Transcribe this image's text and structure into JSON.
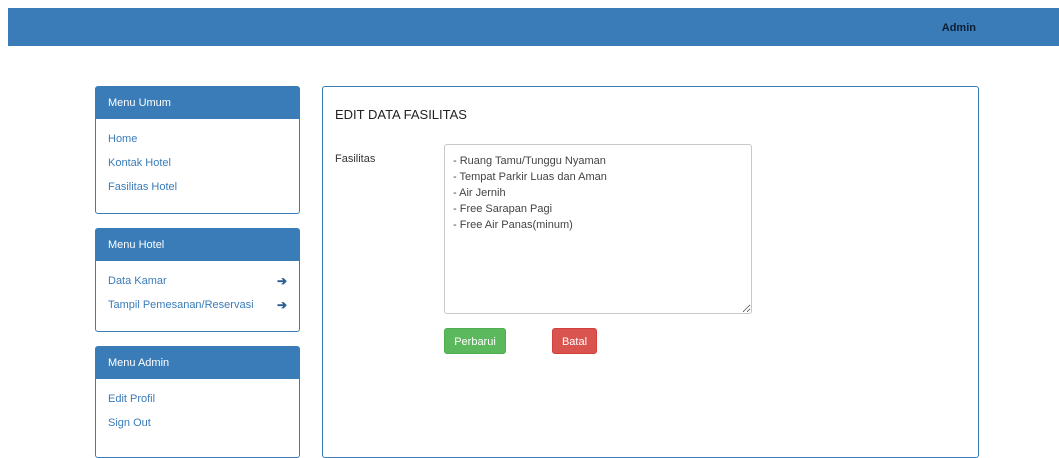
{
  "header": {
    "user_label": "Admin"
  },
  "sidebar": {
    "menu_umum": {
      "title": "Menu Umum",
      "items": [
        {
          "label": "Home"
        },
        {
          "label": "Kontak Hotel"
        },
        {
          "label": "Fasilitas Hotel"
        }
      ]
    },
    "menu_hotel": {
      "title": "Menu Hotel",
      "items": [
        {
          "label": "Data Kamar",
          "icon": "arrow-right-icon"
        },
        {
          "label": "Tampil Pemesanan/Reservasi",
          "icon": "arrow-right-icon"
        }
      ]
    },
    "menu_admin": {
      "title": "Menu Admin",
      "items": [
        {
          "label": "Edit Profil"
        },
        {
          "label": "Sign Out"
        }
      ]
    }
  },
  "main": {
    "title": "EDIT DATA FASILITAS",
    "field_label": "Fasilitas",
    "fasilitas_value": "- Ruang Tamu/Tunggu Nyaman\n- Tempat Parkir Luas dan Aman\n- Air Jernih\n- Free Sarapan Pagi\n- Free Air Panas(minum)",
    "update_button": "Perbarui",
    "cancel_button": "Batal"
  },
  "colors": {
    "primary": "#3a7cb8",
    "success": "#5cb85c",
    "danger": "#d9534f"
  }
}
